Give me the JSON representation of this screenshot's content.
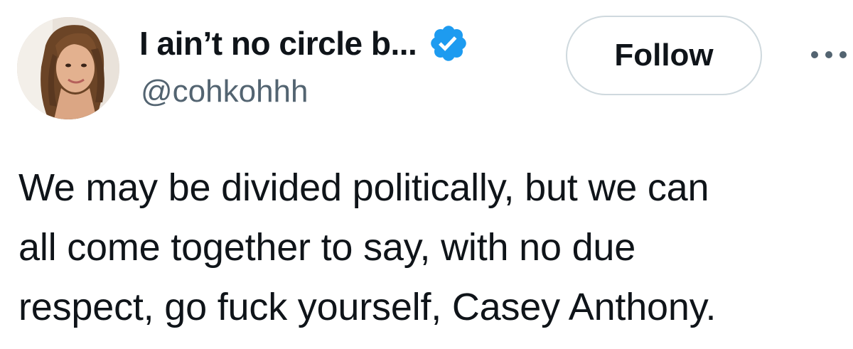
{
  "author": {
    "display_name": "I ain’t no circle b...",
    "handle": "@cohkohhh",
    "avatar_icon": "profile-photo",
    "verified_icon": "verified-badge-icon",
    "verified_color": "#1d9bf0"
  },
  "actions": {
    "follow_label": "Follow",
    "more_icon": "more-options-icon"
  },
  "tweet": {
    "lines": [
      "We may be divided politically, but we can",
      "all come together to say, with no due",
      "respect, go fuck yourself, Casey Anthony."
    ]
  },
  "colors": {
    "text": "#0f1419",
    "secondary_text": "#536471",
    "border": "#cfd9de",
    "accent": "#1d9bf0"
  }
}
